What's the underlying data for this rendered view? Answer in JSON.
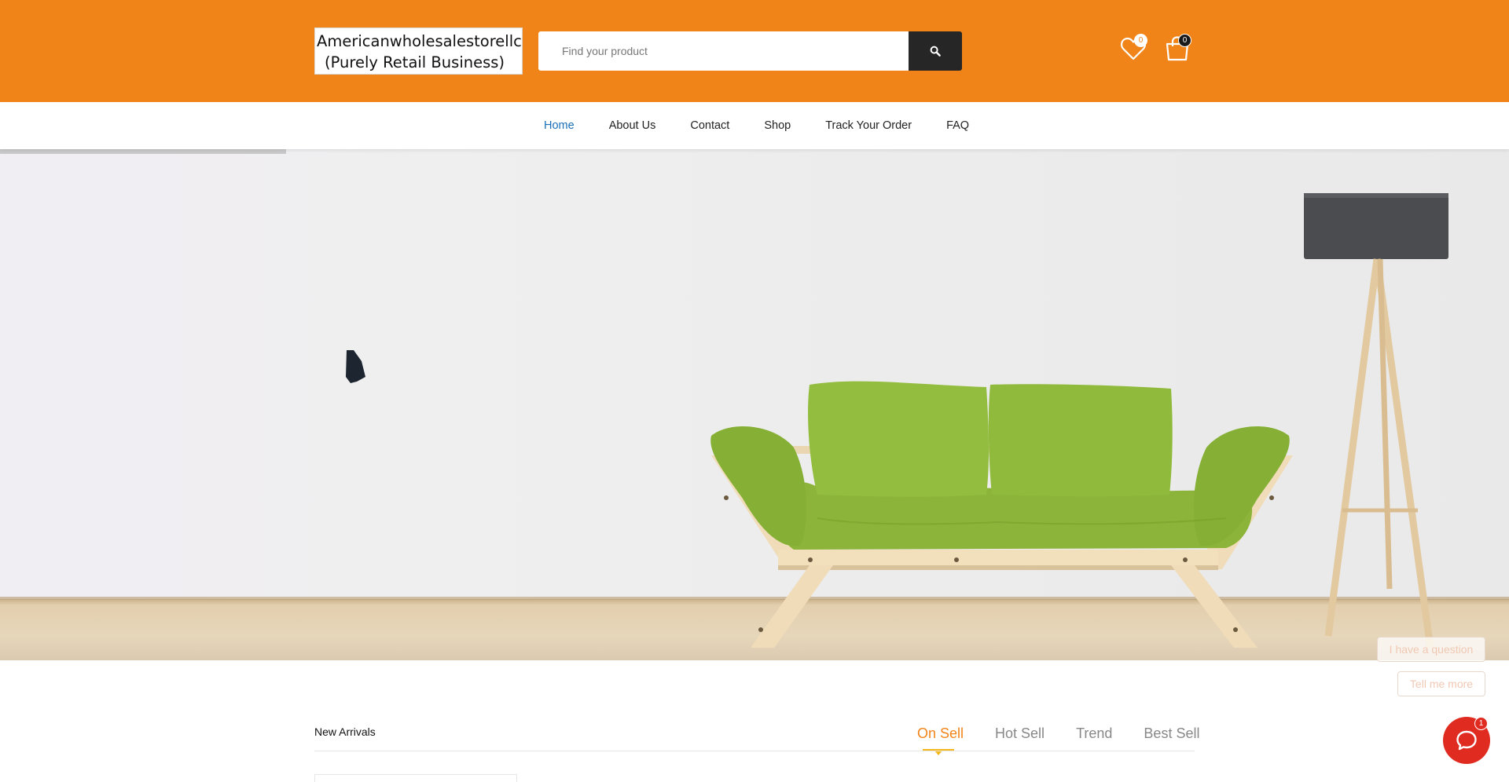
{
  "header": {
    "logo_line1": "Americanwholesalestorellc",
    "logo_line2": "(Purely Retail Business)",
    "search_placeholder": "Find your product",
    "wishlist_count": "0",
    "cart_count": "0",
    "brand_color": "#f18419"
  },
  "nav": {
    "items": [
      {
        "label": "Home",
        "active": true
      },
      {
        "label": "About Us"
      },
      {
        "label": "Contact"
      },
      {
        "label": "Shop"
      },
      {
        "label": "Track Your Order"
      },
      {
        "label": "FAQ"
      }
    ],
    "active_color": "#1a6fb8"
  },
  "hero": {
    "image": "sofa-with-lamp-photo",
    "slider_progress": 0.19
  },
  "chat": {
    "options": [
      "I have a question",
      "Tell me more"
    ],
    "unread": "1",
    "icon": "chat-bubble-icon"
  },
  "section": {
    "title": "New Arrivals",
    "tabs": [
      {
        "label": "On Sell",
        "active": true
      },
      {
        "label": "Hot Sell"
      },
      {
        "label": "Trend"
      },
      {
        "label": "Best Sell"
      }
    ]
  }
}
